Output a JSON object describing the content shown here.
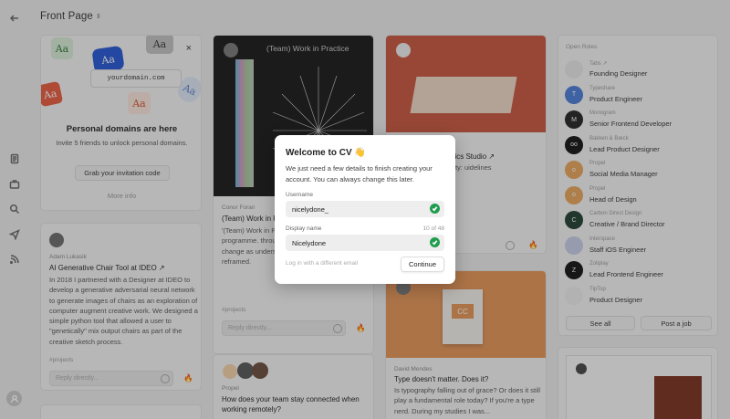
{
  "page": {
    "title": "Front Page",
    "title_caret": "⇕"
  },
  "promo": {
    "tiles": [
      "Aa",
      "Aa",
      "Aa",
      "Aa",
      "Aa",
      "Aa"
    ],
    "domain": "yourdomain.com",
    "close_label": "×",
    "title": "Personal domains are here",
    "subtitle": "Invite 5 friends to unlock personal domains.",
    "button": "Grab your invitation code",
    "more": "More info"
  },
  "post_adam": {
    "author": "Adam Lukasik",
    "title": "AI Generative Chair Tool at IDEO ↗",
    "body": "In 2018 I partnered with a Designer at IDEO to develop a generative adversarial neural network to generate images of chairs as an exploration of computer augment creative work. We designed a simple python tool that allowed a user to \"genetically\" mix output chairs as part of the creative sketch process.",
    "tags": "#projects",
    "reply_placeholder": "Reply directly..."
  },
  "post_conor": {
    "image_title": "(Team) Work in Practice",
    "author": "Conor Foran",
    "title": "(Team) Work in P",
    "body": "'(Team) Work in P opinions and tho the programme. throughout the re reflecting inclusi change as understandings, perspectives and reframed.",
    "tags": "#projects",
    "reply_placeholder": "Reply directly..."
  },
  "post_ceramics": {
    "title": "ui Caramics Studio ↗",
    "body": "and Identity: uidelines"
  },
  "post_typo": {
    "card_text": "CC",
    "author": "David Mendes",
    "title": "Type doesn't matter. Does it?",
    "body": "Is typography falling out of grace? Or does it still play a fundamental role today? If you're a type nerd. During my studies I was..."
  },
  "post_propel": {
    "author": "Propel",
    "title": "How does your team stay connected when working remotely?"
  },
  "open_roles": {
    "header": "Open Roles",
    "roles": [
      {
        "company": "Tabs ↗",
        "position": "Founding Designer",
        "logo": "",
        "color": "#e8e8e8"
      },
      {
        "company": "Typeshare",
        "position": "Product Engineer",
        "logo": "T",
        "color": "#4a7bd8"
      },
      {
        "company": "Monogram",
        "position": "Senior Frontend Developer",
        "logo": "M",
        "color": "#222222"
      },
      {
        "company": "Bakken & Bæck",
        "position": "Lead Product Designer",
        "logo": "oo",
        "color": "#111111"
      },
      {
        "company": "Propel",
        "position": "Social Media Manager",
        "logo": "o",
        "color": "#e8a55a"
      },
      {
        "company": "Propel",
        "position": "Head of Design",
        "logo": "o",
        "color": "#e8a55a"
      },
      {
        "company": "Carbon Direct Design",
        "position": "Creative / Brand Director",
        "logo": "C",
        "color": "#1f3d2e"
      },
      {
        "company": "Interspace",
        "position": "Staff iOS Engineer",
        "logo": "",
        "color": "#c8cde8"
      },
      {
        "company": "Zoliplay",
        "position": "Lead Frontend Engineer",
        "logo": "Z",
        "color": "#111111"
      },
      {
        "company": "TipTop",
        "position": "Product Designer",
        "logo": "",
        "color": "#eeeeee"
      }
    ],
    "see_all": "See all",
    "post_job": "Post a job"
  },
  "modal": {
    "title": "Welcome to CV 👋",
    "description": "We just need a few details to finish creating your account. You can always change this later.",
    "username_label": "Username",
    "username_value": "nicelydone_",
    "display_name_label": "Display name",
    "display_name_count": "10 of 48",
    "display_name_value": "Nicelydone",
    "alt_login": "Log in with a different email",
    "continue": "Continue"
  }
}
